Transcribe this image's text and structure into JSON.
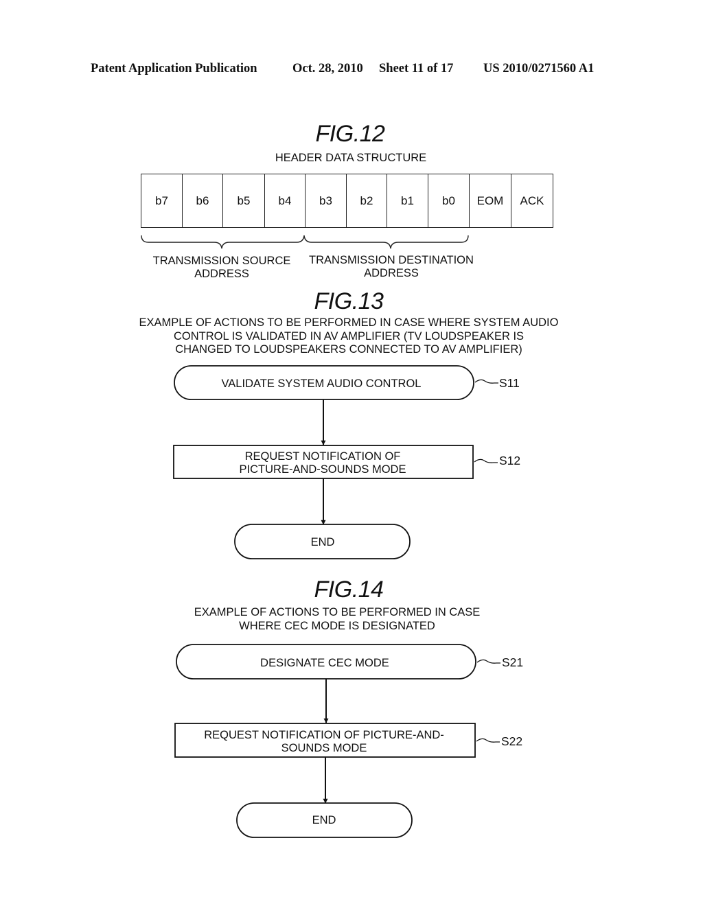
{
  "header": {
    "publication": "Patent Application Publication",
    "date": "Oct. 28, 2010",
    "sheet": "Sheet 11 of 17",
    "number": "US 2010/0271560 A1"
  },
  "fig12": {
    "title": "FIG.12",
    "caption": "HEADER DATA STRUCTURE",
    "cells": [
      "b7",
      "b6",
      "b5",
      "b4",
      "b3",
      "b2",
      "b1",
      "b0",
      "EOM",
      "ACK"
    ],
    "groups": [
      {
        "lines": [
          "TRANSMISSION SOURCE",
          "ADDRESS"
        ],
        "spans": "b7-b4"
      },
      {
        "lines": [
          "TRANSMISSION DESTINATION",
          "ADDRESS"
        ],
        "spans": "b3-b0"
      }
    ]
  },
  "fig13": {
    "title": "FIG.13",
    "caption_lines": [
      "EXAMPLE OF ACTIONS TO BE PERFORMED IN CASE WHERE SYSTEM AUDIO",
      "CONTROL IS VALIDATED IN AV AMPLIFIER (TV LOUDSPEAKER IS",
      "CHANGED TO LOUDSPEAKERS CONNECTED TO AV AMPLIFIER)"
    ],
    "steps": [
      {
        "id": "S11",
        "shape": "terminal",
        "lines": [
          "VALIDATE SYSTEM AUDIO CONTROL"
        ]
      },
      {
        "id": "S12",
        "shape": "process",
        "lines": [
          "REQUEST NOTIFICATION OF",
          "PICTURE-AND-SOUNDS MODE"
        ]
      },
      {
        "id": "",
        "shape": "terminal",
        "lines": [
          "END"
        ]
      }
    ]
  },
  "fig14": {
    "title": "FIG.14",
    "caption_lines": [
      "EXAMPLE OF ACTIONS TO BE PERFORMED IN CASE",
      "WHERE CEC MODE IS DESIGNATED"
    ],
    "steps": [
      {
        "id": "S21",
        "shape": "terminal",
        "lines": [
          "DESIGNATE CEC MODE"
        ]
      },
      {
        "id": "S22",
        "shape": "process",
        "lines": [
          "REQUEST NOTIFICATION OF PICTURE-AND-",
          "SOUNDS MODE"
        ]
      },
      {
        "id": "",
        "shape": "terminal",
        "lines": [
          "END"
        ]
      }
    ]
  }
}
